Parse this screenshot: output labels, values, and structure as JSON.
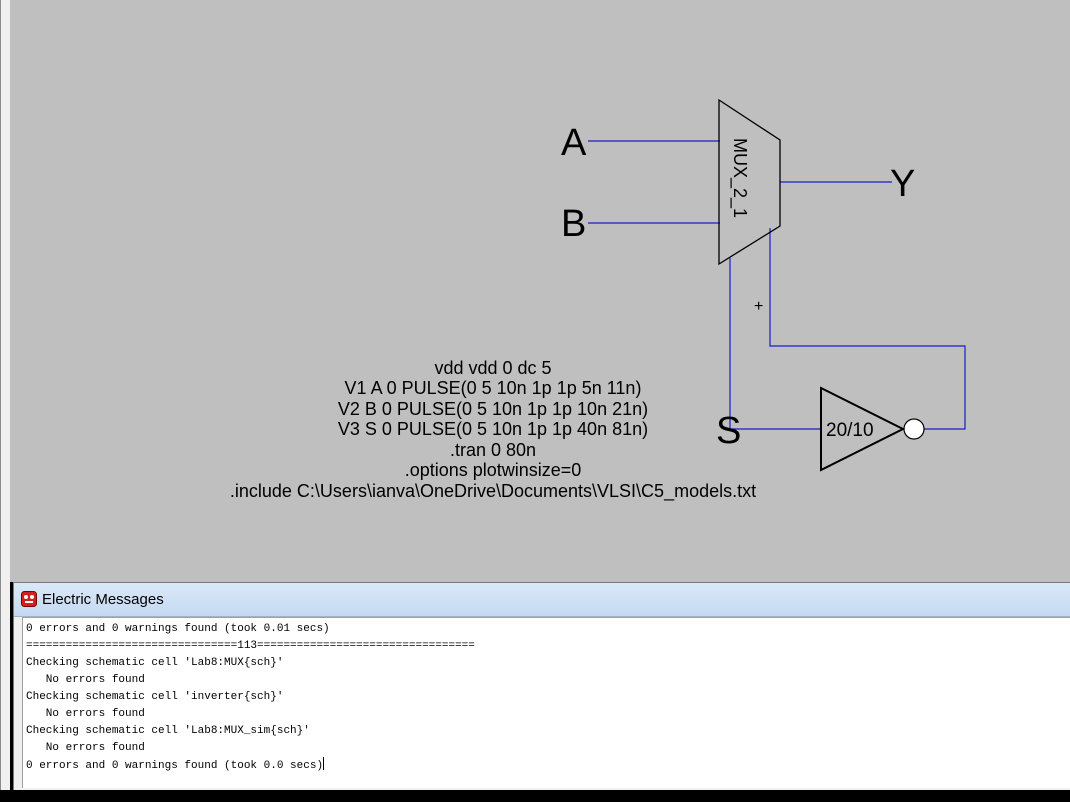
{
  "schematic": {
    "mux_label": "MUX_2_1",
    "pin_a": "A",
    "pin_b": "B",
    "pin_y": "Y",
    "pin_s": "S",
    "inverter_label": "20/10",
    "plus_marker": "+",
    "wire_color": "#1a1acc",
    "spice_lines": [
      "vdd vdd 0 dc 5",
      "V1 A 0 PULSE(0 5 10n 1p 1p 5n 11n)",
      "V2 B 0 PULSE(0 5 10n 1p 1p 10n 21n)",
      "V3 S 0 PULSE(0 5 10n 1p 1p 40n 81n)",
      ".tran 0 80n",
      ".options plotwinsize=0",
      ".include C:\\Users\\ianva\\OneDrive\\Documents\\VLSI\\C5_models.txt"
    ]
  },
  "messages_window": {
    "title": "Electric Messages",
    "icon": "electric-app-icon",
    "lines": [
      "0 errors and 0 warnings found (took 0.01 secs)",
      "================================113=================================",
      "Checking schematic cell 'Lab8:MUX{sch}'",
      "   No errors found",
      "Checking schematic cell 'inverter{sch}'",
      "   No errors found",
      "Checking schematic cell 'Lab8:MUX_sim{sch}'",
      "   No errors found",
      "0 errors and 0 warnings found (took 0.0 secs)"
    ]
  }
}
